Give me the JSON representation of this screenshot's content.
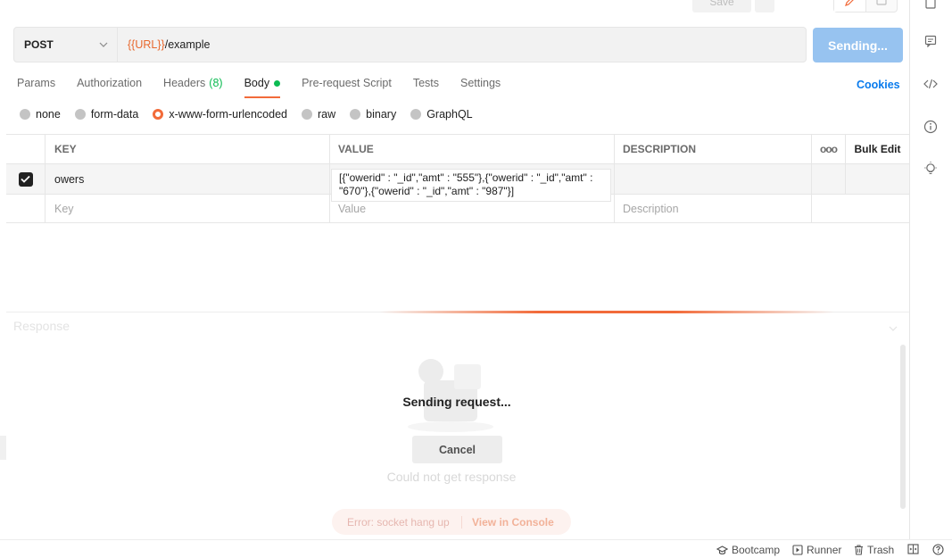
{
  "toolbar": {
    "save_label": "Save"
  },
  "request": {
    "method": "POST",
    "url_variable": "{{URL}}",
    "url_path": "/example",
    "send_label": "Sending..."
  },
  "tabs": {
    "params": "Params",
    "authorization": "Authorization",
    "headers": "Headers",
    "headers_count": "(8)",
    "body": "Body",
    "prerequest": "Pre-request Script",
    "tests": "Tests",
    "settings": "Settings",
    "cookies": "Cookies"
  },
  "body_types": {
    "none": "none",
    "form_data": "form-data",
    "urlencoded": "x-www-form-urlencoded",
    "raw": "raw",
    "binary": "binary",
    "graphql": "GraphQL",
    "selected": "x-www-form-urlencoded"
  },
  "table": {
    "headers": {
      "key": "KEY",
      "value": "VALUE",
      "description": "DESCRIPTION",
      "more": "ooo",
      "bulk_edit": "Bulk Edit"
    },
    "rows": [
      {
        "checked": true,
        "key": "owers",
        "value": "[{\"owerid\" : \"_id\",\"amt\" : \"555\"},{\"owerid\" : \"_id\",\"amt\" : \"670\"},{\"owerid\" : \"_id\",\"amt\" : \"987\"}]",
        "description": ""
      }
    ],
    "placeholders": {
      "key": "Key",
      "value": "Value",
      "description": "Description"
    }
  },
  "response": {
    "label": "Response",
    "sending_text": "Sending request...",
    "cancel_label": "Cancel",
    "could_not": "Could not get response",
    "error_text": "Error: socket hang up",
    "view_console": "View in Console"
  },
  "statusbar": {
    "bootcamp": "Bootcamp",
    "runner": "Runner",
    "trash": "Trash"
  },
  "colors": {
    "accent": "#f26b3a",
    "send_button": "#97c3f0",
    "link_blue": "#097bed",
    "success_green": "#0cbb52"
  }
}
